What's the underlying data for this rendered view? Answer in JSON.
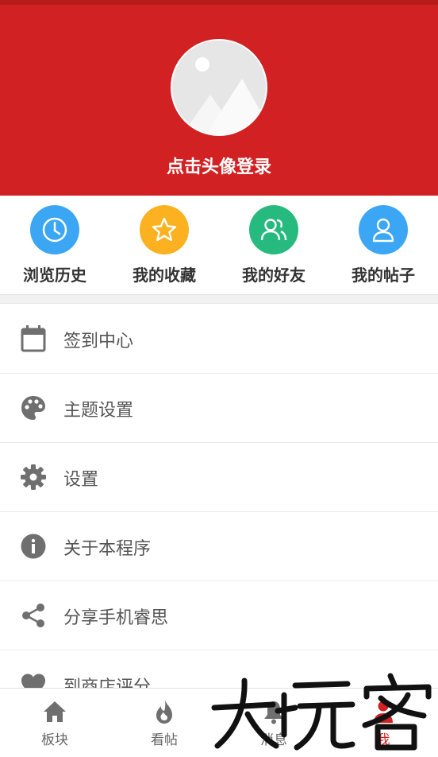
{
  "header": {
    "login_text": "点击头像登录",
    "background": "#d22122"
  },
  "quick_actions": [
    {
      "label": "浏览历史",
      "icon": "clock-icon",
      "color": "#3aa6f4"
    },
    {
      "label": "我的收藏",
      "icon": "star-icon",
      "color": "#fbb120"
    },
    {
      "label": "我的好友",
      "icon": "friends-icon",
      "color": "#27ba7e"
    },
    {
      "label": "我的帖子",
      "icon": "person-icon",
      "color": "#3aa6f4"
    }
  ],
  "menu": [
    {
      "label": "签到中心",
      "icon": "calendar-icon"
    },
    {
      "label": "主题设置",
      "icon": "palette-icon"
    },
    {
      "label": "设置",
      "icon": "gear-icon"
    },
    {
      "label": "关于本程序",
      "icon": "info-icon"
    },
    {
      "label": "分享手机睿思",
      "icon": "share-icon"
    },
    {
      "label": "到商店评分",
      "icon": "heart-icon"
    }
  ],
  "tabs": [
    {
      "label": "板块",
      "icon": "home-icon",
      "active": false
    },
    {
      "label": "看帖",
      "icon": "flame-icon",
      "active": false
    },
    {
      "label": "消息",
      "icon": "bell-icon",
      "active": false
    },
    {
      "label": "我",
      "icon": "me-icon",
      "active": true
    }
  ],
  "watermark": {
    "text": "大玩客"
  },
  "colors": {
    "accent": "#d22122",
    "icon_gray": "#6f6f6f"
  }
}
